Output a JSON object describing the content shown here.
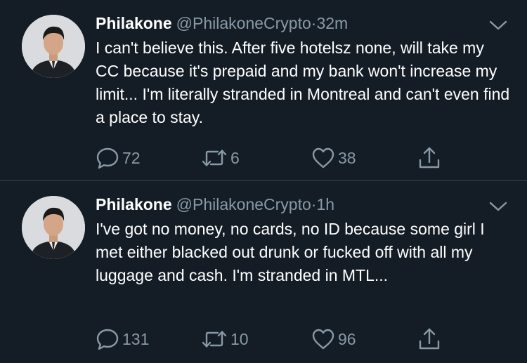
{
  "tweets": [
    {
      "name": "Philakone",
      "handle": "@PhilakoneCrypto",
      "dot": "·",
      "time": "32m",
      "text": "I can't believe this. After five hotelsz none, will take my CC because it's prepaid and my bank won't increase my limit... I'm literally stranded in Montreal and can't even find a place to stay.",
      "replies": "72",
      "retweets": "6",
      "likes": "38"
    },
    {
      "name": "Philakone",
      "handle": "@PhilakoneCrypto",
      "dot": "·",
      "time": "1h",
      "text": "I've got no money, no cards, no ID because some girl I met either blacked out drunk or fucked off with all my luggage and cash. I'm stranded in MTL...",
      "replies": "131",
      "retweets": "10",
      "likes": "96"
    }
  ],
  "colors": {
    "background": "#141d26",
    "muted": "#8899a6",
    "divider": "#38444d"
  },
  "icons": [
    "avatar",
    "chevron-down-icon",
    "reply-icon",
    "retweet-icon",
    "like-icon",
    "share-icon"
  ]
}
